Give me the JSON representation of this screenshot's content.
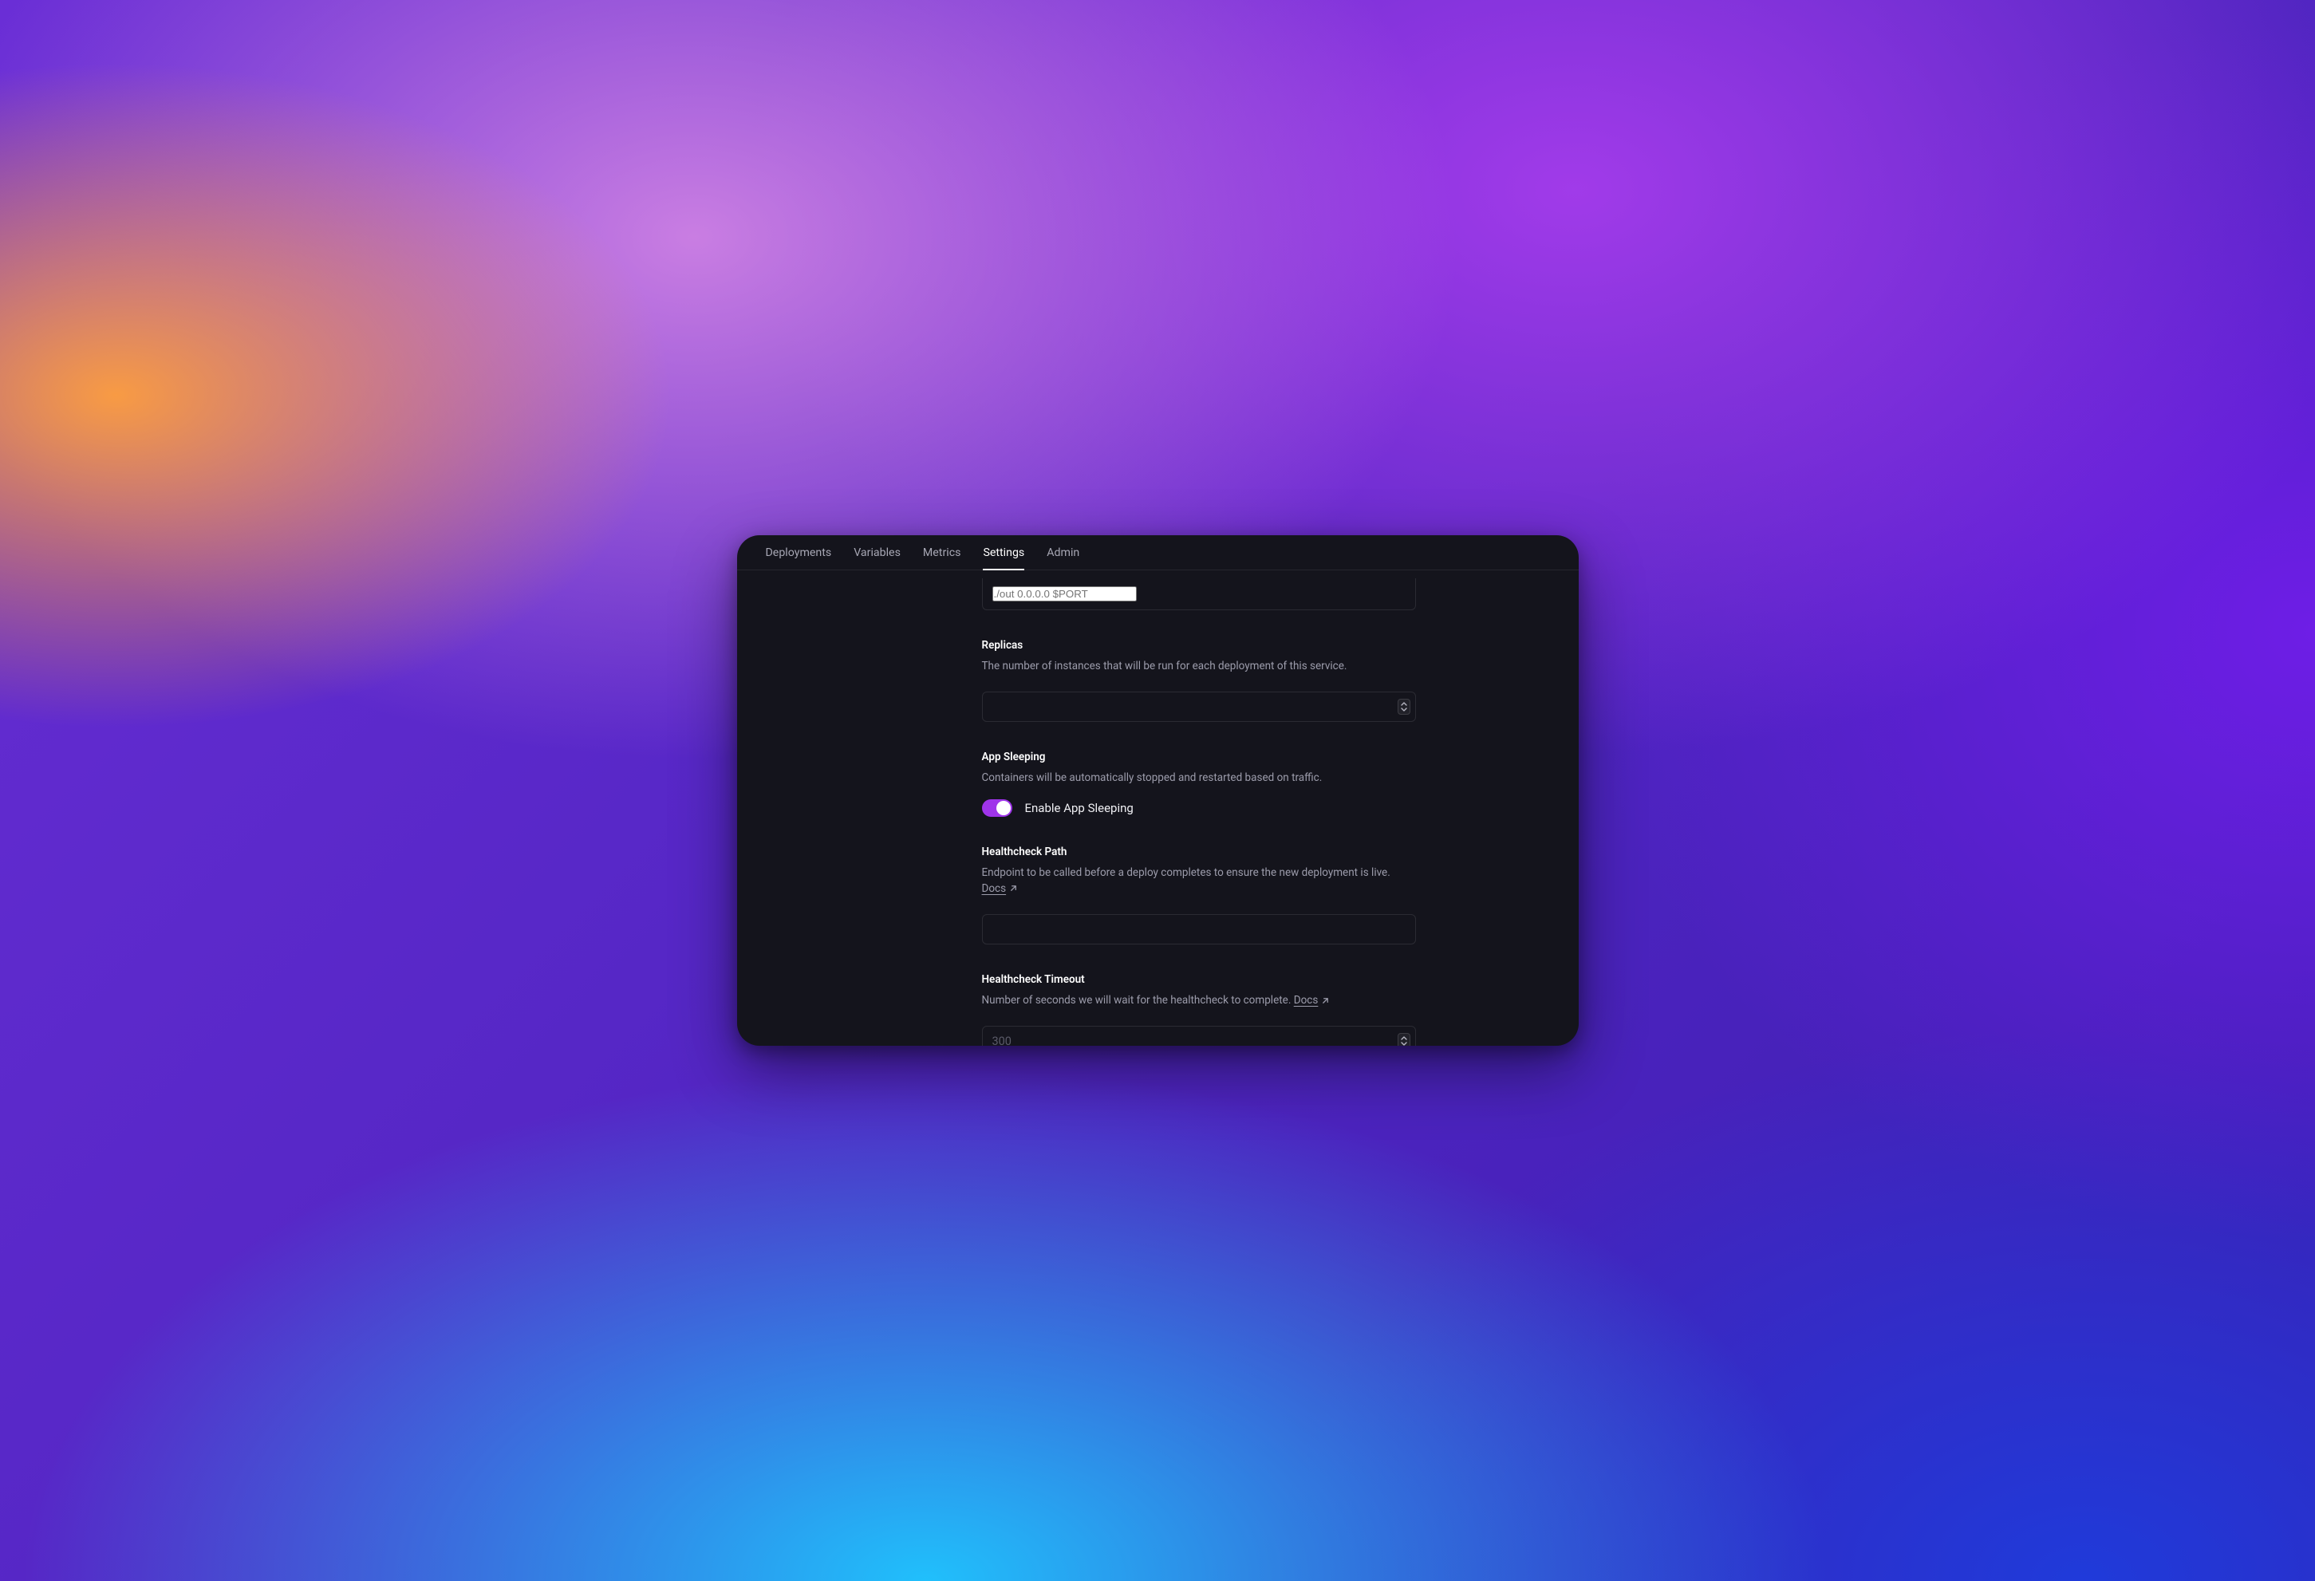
{
  "tabs": {
    "deployments": "Deployments",
    "variables": "Variables",
    "metrics": "Metrics",
    "settings": "Settings",
    "admin": "Admin",
    "active": "settings"
  },
  "top_field": {
    "placeholder": "./out 0.0.0.0 $PORT",
    "value": ""
  },
  "replicas": {
    "title": "Replicas",
    "desc": "The number of instances that will be run for each deployment of this service.",
    "value": ""
  },
  "app_sleeping": {
    "title": "App Sleeping",
    "desc": "Containers will be automatically stopped and restarted based on traffic.",
    "toggle_label": "Enable App Sleeping",
    "enabled": true
  },
  "healthcheck_path": {
    "title": "Healthcheck Path",
    "desc": "Endpoint to be called before a deploy completes to ensure the new deployment is live. ",
    "docs_label": "Docs",
    "value": ""
  },
  "healthcheck_timeout": {
    "title": "Healthcheck Timeout",
    "desc": "Number of seconds we will wait for the healthcheck to complete. ",
    "docs_label": "Docs",
    "placeholder": "300",
    "value": ""
  },
  "colors": {
    "accent": "#9f34ea",
    "bg": "#14141c"
  }
}
